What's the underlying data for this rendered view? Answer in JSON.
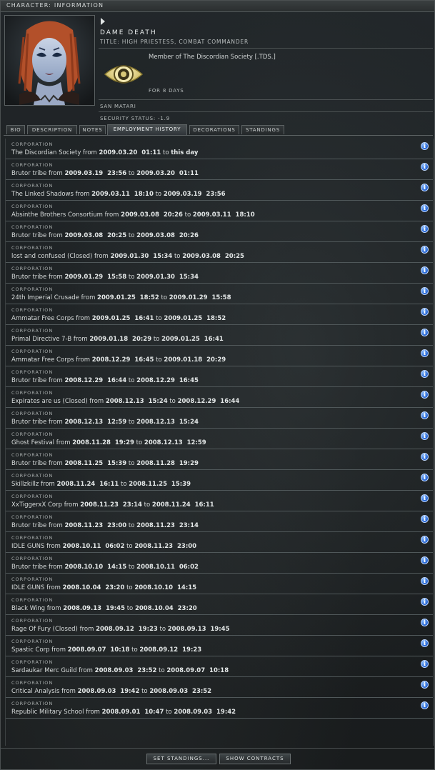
{
  "window": {
    "title": "CHARACTER: INFORMATION"
  },
  "character": {
    "name": "DAME DEATH",
    "title": "TITLE: HIGH PRIESTESS, COMBAT COMMANDER",
    "member_of": "Member of The Discordian Society [.TDS.]",
    "for_days": "FOR 8 DAYS",
    "race": "SAN MATARI",
    "security_status": "SECURITY STATUS: -1.9"
  },
  "tabs": [
    {
      "label": "BIO"
    },
    {
      "label": "DESCRIPTION"
    },
    {
      "label": "NOTES"
    },
    {
      "label": "EMPLOYMENT HISTORY",
      "active": true
    },
    {
      "label": "DECORATIONS"
    },
    {
      "label": "STANDINGS"
    }
  ],
  "employment": {
    "row_type": "CORPORATION",
    "from_word": "from",
    "to_word": "to",
    "rows": [
      {
        "corp": "The Discordian Society",
        "from": "2009.03.20  01:11",
        "to": "this day"
      },
      {
        "corp": "Brutor tribe",
        "from": "2009.03.19  23:56",
        "to": "2009.03.20  01:11"
      },
      {
        "corp": "The Linked Shadows",
        "from": "2009.03.11  18:10",
        "to": "2009.03.19  23:56"
      },
      {
        "corp": "Absinthe Brothers Consortium",
        "from": "2009.03.08  20:26",
        "to": "2009.03.11  18:10"
      },
      {
        "corp": "Brutor tribe",
        "from": "2009.03.08  20:25",
        "to": "2009.03.08  20:26"
      },
      {
        "corp": "lost and confused (Closed)",
        "from": "2009.01.30  15:34",
        "to": "2009.03.08  20:25"
      },
      {
        "corp": "Brutor tribe",
        "from": "2009.01.29  15:58",
        "to": "2009.01.30  15:34"
      },
      {
        "corp": "24th Imperial Crusade",
        "from": "2009.01.25  18:52",
        "to": "2009.01.29  15:58"
      },
      {
        "corp": "Ammatar Free Corps",
        "from": "2009.01.25  16:41",
        "to": "2009.01.25  18:52"
      },
      {
        "corp": "Primal Directive 7-B",
        "from": "2009.01.18  20:29",
        "to": "2009.01.25  16:41"
      },
      {
        "corp": "Ammatar Free Corps",
        "from": "2008.12.29  16:45",
        "to": "2009.01.18  20:29"
      },
      {
        "corp": "Brutor tribe",
        "from": "2008.12.29  16:44",
        "to": "2008.12.29  16:45"
      },
      {
        "corp": "Expirates are us (Closed)",
        "from": "2008.12.13  15:24",
        "to": "2008.12.29  16:44"
      },
      {
        "corp": "Brutor tribe",
        "from": "2008.12.13  12:59",
        "to": "2008.12.13  15:24"
      },
      {
        "corp": "Ghost Festival",
        "from": "2008.11.28  19:29",
        "to": "2008.12.13  12:59"
      },
      {
        "corp": "Brutor tribe",
        "from": "2008.11.25  15:39",
        "to": "2008.11.28  19:29"
      },
      {
        "corp": "Skillzkillz",
        "from": "2008.11.24  16:11",
        "to": "2008.11.25  15:39"
      },
      {
        "corp": "XxTiggerxX Corp",
        "from": "2008.11.23  23:14",
        "to": "2008.11.24  16:11"
      },
      {
        "corp": "Brutor tribe",
        "from": "2008.11.23  23:00",
        "to": "2008.11.23  23:14"
      },
      {
        "corp": "IDLE GUNS",
        "from": "2008.10.11  06:02",
        "to": "2008.11.23  23:00"
      },
      {
        "corp": "Brutor tribe",
        "from": "2008.10.10  14:15",
        "to": "2008.10.11  06:02"
      },
      {
        "corp": "IDLE GUNS",
        "from": "2008.10.04  23:20",
        "to": "2008.10.10  14:15"
      },
      {
        "corp": "Black Wing",
        "from": "2008.09.13  19:45",
        "to": "2008.10.04  23:20"
      },
      {
        "corp": "Rage Of Fury (Closed)",
        "from": "2008.09.12  19:23",
        "to": "2008.09.13  19:45"
      },
      {
        "corp": "Spastic Corp",
        "from": "2008.09.07  10:18",
        "to": "2008.09.12  19:23"
      },
      {
        "corp": "Sardaukar Merc Guild",
        "from": "2008.09.03  23:52",
        "to": "2008.09.07  10:18"
      },
      {
        "corp": "Critical Analysis",
        "from": "2008.09.03  19:42",
        "to": "2008.09.03  23:52"
      },
      {
        "corp": "Republic Military School",
        "from": "2008.09.01  10:47",
        "to": "2008.09.03  19:42"
      }
    ]
  },
  "buttons": {
    "set_standings": "SET STANDINGS...",
    "show_contracts": "SHOW CONTRACTS"
  },
  "icons": {
    "info": "info-icon",
    "expand": "triangle-right-icon",
    "corp_logo": "eye-icon"
  },
  "colors": {
    "info_blue": "#1f5fd0",
    "corp_logo_gold": "#d8c878"
  }
}
